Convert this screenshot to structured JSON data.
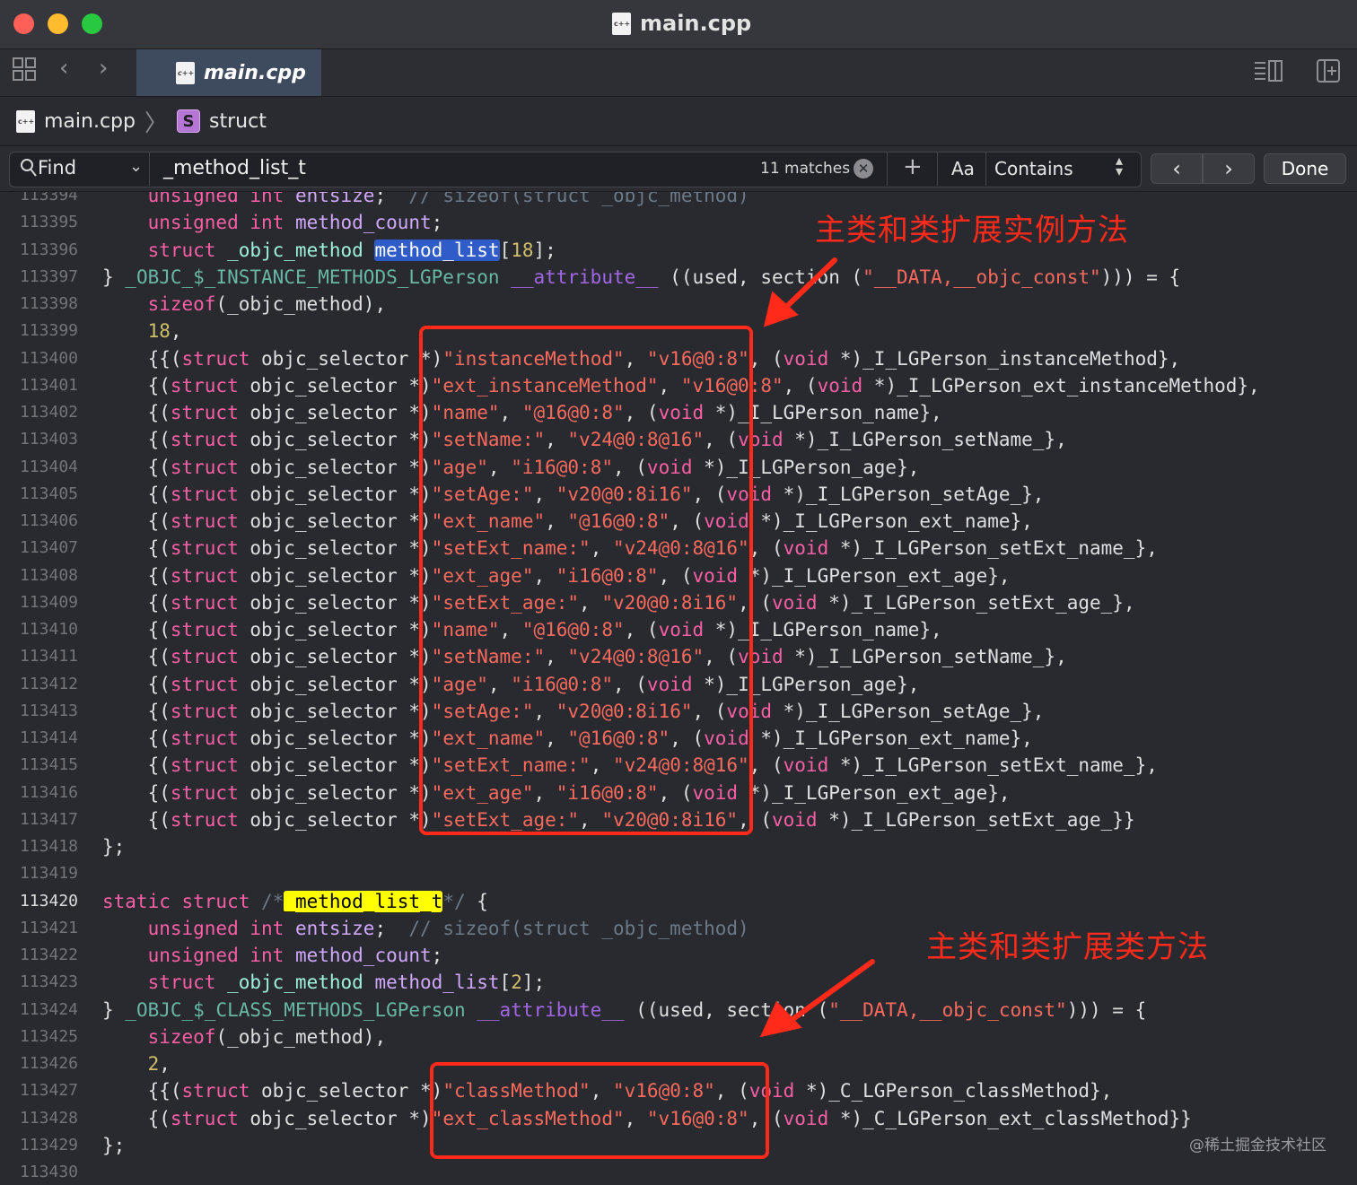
{
  "window": {
    "title": "main.cpp",
    "tab_label": "main.cpp"
  },
  "jumpbar": {
    "file": "main.cpp",
    "symbol_badge": "S",
    "symbol": "struct"
  },
  "find": {
    "label": "Find",
    "query": "_method_list_t",
    "matches": "11 matches",
    "case_toggle": "Aa",
    "mode": "Contains",
    "done_label": "Done"
  },
  "annotations": {
    "instance_label": "主类和类扩展实例方法",
    "class_label": "主类和类扩展类方法",
    "watermark": "@稀土掘金技术社区"
  },
  "colors": {
    "annotation_red": "#ff2a1a",
    "search_highlight": "#ffff00",
    "selection_highlight": "#2f5cc8"
  },
  "code": {
    "lines": [
      {
        "n": "113394",
        "segs": [
          [
            "k",
            "    unsigned int "
          ],
          [
            "ty",
            "entsize"
          ],
          [
            "o",
            ";  "
          ],
          [
            "c",
            "// sizeof(struct _objc_method)"
          ]
        ]
      },
      {
        "n": "113395",
        "segs": [
          [
            "k",
            "    unsigned int "
          ],
          [
            "ty",
            "method_count"
          ],
          [
            "o",
            ";"
          ]
        ]
      },
      {
        "n": "113396",
        "segs": [
          [
            "k",
            "    struct "
          ],
          [
            "mtype",
            "_objc_method "
          ],
          [
            "sel",
            "method_list"
          ],
          [
            "o",
            "["
          ],
          [
            "n",
            "18"
          ],
          [
            "o",
            "];"
          ]
        ]
      },
      {
        "n": "113397",
        "segs": [
          [
            "o",
            "} "
          ],
          [
            "g",
            "_OBJC_$_INSTANCE_METHODS_LGPerson "
          ],
          [
            "p",
            "__attribute__"
          ],
          [
            "o",
            " ((used, section ("
          ],
          [
            "s",
            "\"__DATA,__objc_const\""
          ],
          [
            "o",
            ")))"
          ],
          [
            "o",
            " = {"
          ]
        ]
      },
      {
        "n": "113398",
        "segs": [
          [
            "k",
            "    sizeof"
          ],
          [
            "o",
            "(_objc_method),"
          ]
        ]
      },
      {
        "n": "113399",
        "segs": [
          [
            "n",
            "    18"
          ],
          [
            "o",
            ","
          ]
        ]
      },
      {
        "n": "113400",
        "segs": [
          [
            "o",
            "    {{("
          ],
          [
            "k",
            "struct "
          ],
          [
            "o",
            "objc_selector *)"
          ],
          [
            "s",
            "\"instanceMethod\""
          ],
          [
            "o",
            ", "
          ],
          [
            "s",
            "\"v16@0:8\""
          ],
          [
            "o",
            ", ("
          ],
          [
            "k",
            "void "
          ],
          [
            "o",
            "*)_I_LGPerson_instanceMethod},"
          ]
        ]
      },
      {
        "n": "113401",
        "segs": [
          [
            "o",
            "    {("
          ],
          [
            "k",
            "struct "
          ],
          [
            "o",
            "objc_selector *)"
          ],
          [
            "s",
            "\"ext_instanceMethod\""
          ],
          [
            "o",
            ", "
          ],
          [
            "s",
            "\"v16@0:8\""
          ],
          [
            "o",
            ", ("
          ],
          [
            "k",
            "void "
          ],
          [
            "o",
            "*)_I_LGPerson_ext_instanceMethod},"
          ]
        ]
      },
      {
        "n": "113402",
        "segs": [
          [
            "o",
            "    {("
          ],
          [
            "k",
            "struct "
          ],
          [
            "o",
            "objc_selector *)"
          ],
          [
            "s",
            "\"name\""
          ],
          [
            "o",
            ", "
          ],
          [
            "s",
            "\"@16@0:8\""
          ],
          [
            "o",
            ", ("
          ],
          [
            "k",
            "void "
          ],
          [
            "o",
            "*)_I_LGPerson_name},"
          ]
        ]
      },
      {
        "n": "113403",
        "segs": [
          [
            "o",
            "    {("
          ],
          [
            "k",
            "struct "
          ],
          [
            "o",
            "objc_selector *)"
          ],
          [
            "s",
            "\"setName:\""
          ],
          [
            "o",
            ", "
          ],
          [
            "s",
            "\"v24@0:8@16\""
          ],
          [
            "o",
            ", ("
          ],
          [
            "k",
            "void "
          ],
          [
            "o",
            "*)_I_LGPerson_setName_},"
          ]
        ]
      },
      {
        "n": "113404",
        "segs": [
          [
            "o",
            "    {("
          ],
          [
            "k",
            "struct "
          ],
          [
            "o",
            "objc_selector *)"
          ],
          [
            "s",
            "\"age\""
          ],
          [
            "o",
            ", "
          ],
          [
            "s",
            "\"i16@0:8\""
          ],
          [
            "o",
            ", ("
          ],
          [
            "k",
            "void "
          ],
          [
            "o",
            "*)_I_LGPerson_age},"
          ]
        ]
      },
      {
        "n": "113405",
        "segs": [
          [
            "o",
            "    {("
          ],
          [
            "k",
            "struct "
          ],
          [
            "o",
            "objc_selector *)"
          ],
          [
            "s",
            "\"setAge:\""
          ],
          [
            "o",
            ", "
          ],
          [
            "s",
            "\"v20@0:8i16\""
          ],
          [
            "o",
            ", ("
          ],
          [
            "k",
            "void "
          ],
          [
            "o",
            "*)_I_LGPerson_setAge_},"
          ]
        ]
      },
      {
        "n": "113406",
        "segs": [
          [
            "o",
            "    {("
          ],
          [
            "k",
            "struct "
          ],
          [
            "o",
            "objc_selector *)"
          ],
          [
            "s",
            "\"ext_name\""
          ],
          [
            "o",
            ", "
          ],
          [
            "s",
            "\"@16@0:8\""
          ],
          [
            "o",
            ", ("
          ],
          [
            "k",
            "void "
          ],
          [
            "o",
            "*)_I_LGPerson_ext_name},"
          ]
        ]
      },
      {
        "n": "113407",
        "segs": [
          [
            "o",
            "    {("
          ],
          [
            "k",
            "struct "
          ],
          [
            "o",
            "objc_selector *)"
          ],
          [
            "s",
            "\"setExt_name:\""
          ],
          [
            "o",
            ", "
          ],
          [
            "s",
            "\"v24@0:8@16\""
          ],
          [
            "o",
            ", ("
          ],
          [
            "k",
            "void "
          ],
          [
            "o",
            "*)_I_LGPerson_setExt_name_},"
          ]
        ]
      },
      {
        "n": "113408",
        "segs": [
          [
            "o",
            "    {("
          ],
          [
            "k",
            "struct "
          ],
          [
            "o",
            "objc_selector *)"
          ],
          [
            "s",
            "\"ext_age\""
          ],
          [
            "o",
            ", "
          ],
          [
            "s",
            "\"i16@0:8\""
          ],
          [
            "o",
            ", ("
          ],
          [
            "k",
            "void "
          ],
          [
            "o",
            "*)_I_LGPerson_ext_age},"
          ]
        ]
      },
      {
        "n": "113409",
        "segs": [
          [
            "o",
            "    {("
          ],
          [
            "k",
            "struct "
          ],
          [
            "o",
            "objc_selector *)"
          ],
          [
            "s",
            "\"setExt_age:\""
          ],
          [
            "o",
            ", "
          ],
          [
            "s",
            "\"v20@0:8i16\""
          ],
          [
            "o",
            ", ("
          ],
          [
            "k",
            "void "
          ],
          [
            "o",
            "*)_I_LGPerson_setExt_age_},"
          ]
        ]
      },
      {
        "n": "113410",
        "segs": [
          [
            "o",
            "    {("
          ],
          [
            "k",
            "struct "
          ],
          [
            "o",
            "objc_selector *)"
          ],
          [
            "s",
            "\"name\""
          ],
          [
            "o",
            ", "
          ],
          [
            "s",
            "\"@16@0:8\""
          ],
          [
            "o",
            ", ("
          ],
          [
            "k",
            "void "
          ],
          [
            "o",
            "*)_I_LGPerson_name},"
          ]
        ]
      },
      {
        "n": "113411",
        "segs": [
          [
            "o",
            "    {("
          ],
          [
            "k",
            "struct "
          ],
          [
            "o",
            "objc_selector *)"
          ],
          [
            "s",
            "\"setName:\""
          ],
          [
            "o",
            ", "
          ],
          [
            "s",
            "\"v24@0:8@16\""
          ],
          [
            "o",
            ", ("
          ],
          [
            "k",
            "void "
          ],
          [
            "o",
            "*)_I_LGPerson_setName_},"
          ]
        ]
      },
      {
        "n": "113412",
        "segs": [
          [
            "o",
            "    {("
          ],
          [
            "k",
            "struct "
          ],
          [
            "o",
            "objc_selector *)"
          ],
          [
            "s",
            "\"age\""
          ],
          [
            "o",
            ", "
          ],
          [
            "s",
            "\"i16@0:8\""
          ],
          [
            "o",
            ", ("
          ],
          [
            "k",
            "void "
          ],
          [
            "o",
            "*)_I_LGPerson_age},"
          ]
        ]
      },
      {
        "n": "113413",
        "segs": [
          [
            "o",
            "    {("
          ],
          [
            "k",
            "struct "
          ],
          [
            "o",
            "objc_selector *)"
          ],
          [
            "s",
            "\"setAge:\""
          ],
          [
            "o",
            ", "
          ],
          [
            "s",
            "\"v20@0:8i16\""
          ],
          [
            "o",
            ", ("
          ],
          [
            "k",
            "void "
          ],
          [
            "o",
            "*)_I_LGPerson_setAge_},"
          ]
        ]
      },
      {
        "n": "113414",
        "segs": [
          [
            "o",
            "    {("
          ],
          [
            "k",
            "struct "
          ],
          [
            "o",
            "objc_selector *)"
          ],
          [
            "s",
            "\"ext_name\""
          ],
          [
            "o",
            ", "
          ],
          [
            "s",
            "\"@16@0:8\""
          ],
          [
            "o",
            ", ("
          ],
          [
            "k",
            "void "
          ],
          [
            "o",
            "*)_I_LGPerson_ext_name},"
          ]
        ]
      },
      {
        "n": "113415",
        "segs": [
          [
            "o",
            "    {("
          ],
          [
            "k",
            "struct "
          ],
          [
            "o",
            "objc_selector *)"
          ],
          [
            "s",
            "\"setExt_name:\""
          ],
          [
            "o",
            ", "
          ],
          [
            "s",
            "\"v24@0:8@16\""
          ],
          [
            "o",
            ", ("
          ],
          [
            "k",
            "void "
          ],
          [
            "o",
            "*)_I_LGPerson_setExt_name_},"
          ]
        ]
      },
      {
        "n": "113416",
        "segs": [
          [
            "o",
            "    {("
          ],
          [
            "k",
            "struct "
          ],
          [
            "o",
            "objc_selector *)"
          ],
          [
            "s",
            "\"ext_age\""
          ],
          [
            "o",
            ", "
          ],
          [
            "s",
            "\"i16@0:8\""
          ],
          [
            "o",
            ", ("
          ],
          [
            "k",
            "void "
          ],
          [
            "o",
            "*)_I_LGPerson_ext_age},"
          ]
        ]
      },
      {
        "n": "113417",
        "segs": [
          [
            "o",
            "    {("
          ],
          [
            "k",
            "struct "
          ],
          [
            "o",
            "objc_selector *)"
          ],
          [
            "s",
            "\"setExt_age:\""
          ],
          [
            "o",
            ", "
          ],
          [
            "s",
            "\"v20@0:8i16\""
          ],
          [
            "o",
            ", ("
          ],
          [
            "k",
            "void "
          ],
          [
            "o",
            "*)_I_LGPerson_setExt_age_}}"
          ]
        ]
      },
      {
        "n": "113418",
        "segs": [
          [
            "o",
            "};"
          ]
        ]
      },
      {
        "n": "113419",
        "segs": []
      },
      {
        "n": "113420",
        "current": true,
        "segs": [
          [
            "k",
            "static struct "
          ],
          [
            "c",
            "/*"
          ],
          [
            "find",
            "_method_list_t"
          ],
          [
            "c",
            "*/"
          ],
          [
            "o",
            " {"
          ]
        ]
      },
      {
        "n": "113421",
        "segs": [
          [
            "k",
            "    unsigned int "
          ],
          [
            "ty",
            "entsize"
          ],
          [
            "o",
            ";  "
          ],
          [
            "c",
            "// sizeof(struct _objc_method)"
          ]
        ]
      },
      {
        "n": "113422",
        "segs": [
          [
            "k",
            "    unsigned int "
          ],
          [
            "ty",
            "method_count"
          ],
          [
            "o",
            ";"
          ]
        ]
      },
      {
        "n": "113423",
        "segs": [
          [
            "k",
            "    struct "
          ],
          [
            "mtype",
            "_objc_method "
          ],
          [
            "ty",
            "method_list"
          ],
          [
            "o",
            "["
          ],
          [
            "n",
            "2"
          ],
          [
            "o",
            "];"
          ]
        ]
      },
      {
        "n": "113424",
        "segs": [
          [
            "o",
            "} "
          ],
          [
            "g",
            "_OBJC_$_CLASS_METHODS_LGPerson "
          ],
          [
            "p",
            "__attribute__"
          ],
          [
            "o",
            " ((used, section ("
          ],
          [
            "s",
            "\"__DATA,__objc_const\""
          ],
          [
            "o",
            ")))"
          ],
          [
            "o",
            " = {"
          ]
        ]
      },
      {
        "n": "113425",
        "segs": [
          [
            "k",
            "    sizeof"
          ],
          [
            "o",
            "(_objc_method),"
          ]
        ]
      },
      {
        "n": "113426",
        "segs": [
          [
            "n",
            "    2"
          ],
          [
            "o",
            ","
          ]
        ]
      },
      {
        "n": "113427",
        "segs": [
          [
            "o",
            "    {{("
          ],
          [
            "k",
            "struct "
          ],
          [
            "o",
            "objc_selector *)"
          ],
          [
            "s",
            "\"classMethod\""
          ],
          [
            "o",
            ", "
          ],
          [
            "s",
            "\"v16@0:8\""
          ],
          [
            "o",
            ", ("
          ],
          [
            "k",
            "void "
          ],
          [
            "o",
            "*)_C_LGPerson_classMethod},"
          ]
        ]
      },
      {
        "n": "113428",
        "segs": [
          [
            "o",
            "    {("
          ],
          [
            "k",
            "struct "
          ],
          [
            "o",
            "objc_selector *)"
          ],
          [
            "s",
            "\"ext_classMethod\""
          ],
          [
            "o",
            ", "
          ],
          [
            "s",
            "\"v16@0:8\""
          ],
          [
            "o",
            ", ("
          ],
          [
            "k",
            "void "
          ],
          [
            "o",
            "*)_C_LGPerson_ext_classMethod}}"
          ]
        ]
      },
      {
        "n": "113429",
        "segs": [
          [
            "o",
            "};"
          ]
        ]
      },
      {
        "n": "113430",
        "segs": []
      }
    ]
  }
}
